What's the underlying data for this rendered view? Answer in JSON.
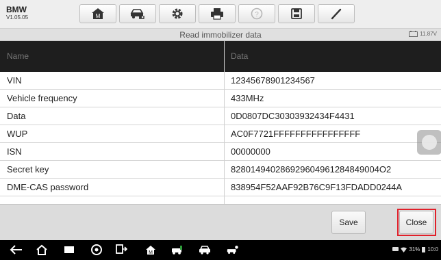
{
  "app": {
    "brand": "BMW",
    "version": "V1.05.05"
  },
  "toolbar": {
    "buttons": [
      {
        "icon": "home-icon"
      },
      {
        "icon": "vehicle-swap-icon"
      },
      {
        "icon": "gear-icon"
      },
      {
        "icon": "printer-icon"
      },
      {
        "icon": "help-icon"
      },
      {
        "icon": "save-icon"
      },
      {
        "icon": "pen-icon"
      }
    ]
  },
  "header": {
    "title": "Read immobilizer data",
    "voltage": "11.87V"
  },
  "table": {
    "columns": [
      "Name",
      "Data"
    ],
    "rows": [
      {
        "name": "VIN",
        "value": "12345678901234567"
      },
      {
        "name": "Vehicle frequency",
        "value": "433MHz"
      },
      {
        "name": "Data",
        "value": "0D0807DC30303932434F4431"
      },
      {
        "name": "WUP",
        "value": "AC0F7721FFFFFFFFFFFFFFFF"
      },
      {
        "name": "ISN",
        "value": "00000000"
      },
      {
        "name": "Secret key",
        "value": "828014940286929604961284849004O2"
      },
      {
        "name": "DME-CAS password",
        "value": "838954F52AAF92B76C9F13FDADD0244A"
      }
    ]
  },
  "actions": {
    "save_label": "Save",
    "close_label": "Close"
  },
  "status": {
    "battery": "31%",
    "time": "10:0"
  },
  "colors": {
    "header_bg": "#1e1e1e",
    "close_highlight": "#e0202a",
    "navbar_bg": "#000000"
  }
}
